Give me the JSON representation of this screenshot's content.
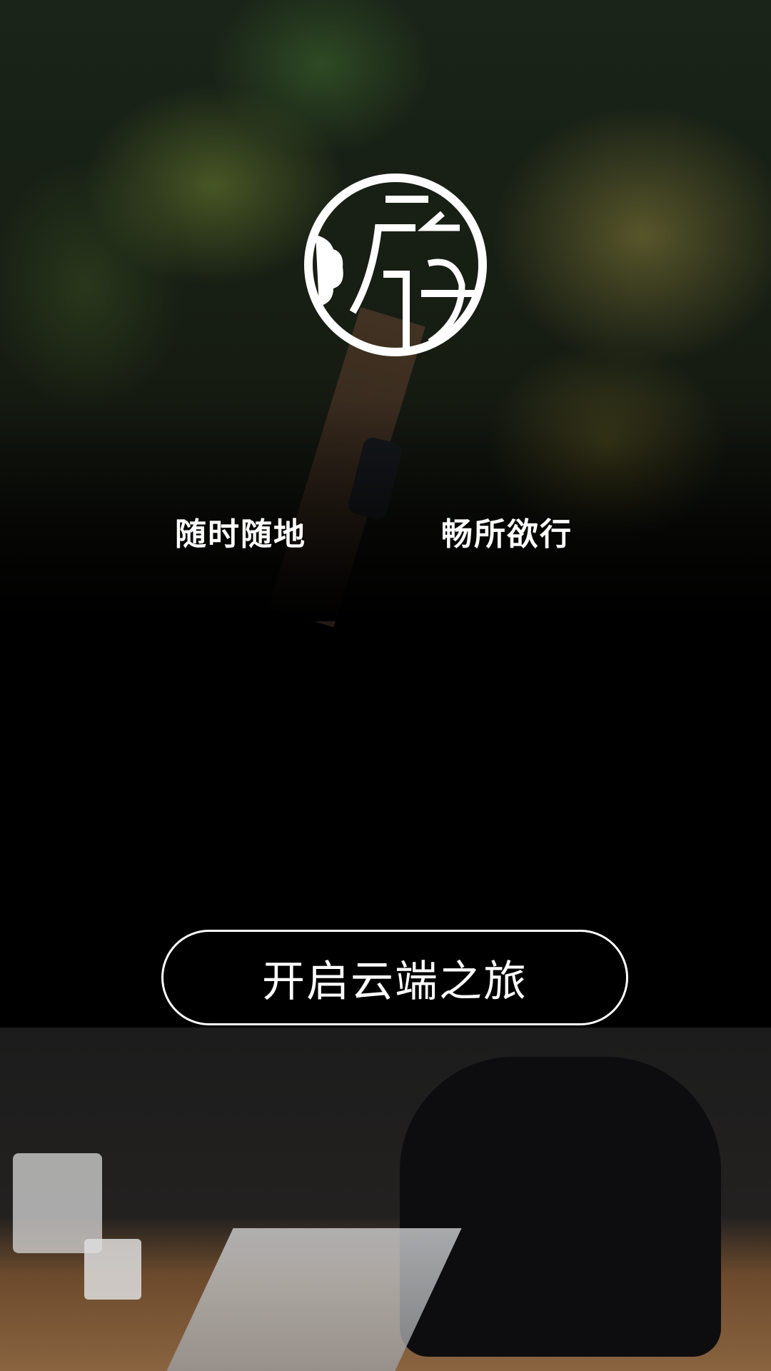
{
  "logo": {
    "glyph": "行",
    "icon": "app-logo-seal"
  },
  "slogan": {
    "left": "随时随地",
    "right": "畅所欲行"
  },
  "cta": {
    "label": "开启云端之旅"
  },
  "colors": {
    "background": "#000000",
    "text": "#ffffff"
  }
}
